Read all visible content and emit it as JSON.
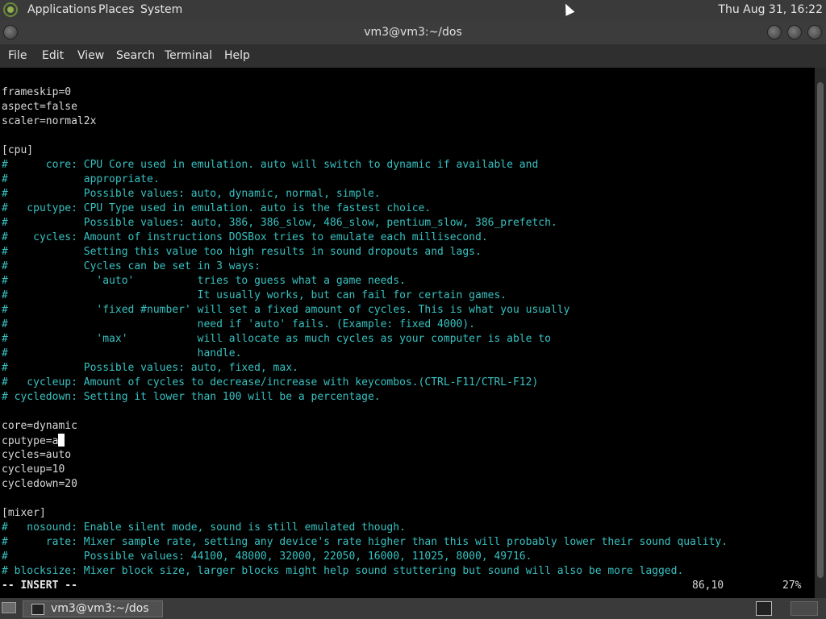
{
  "top_panel": {
    "menus": [
      "Applications",
      "Places",
      "System"
    ],
    "clock": "Thu Aug 31, 16:22"
  },
  "window": {
    "title": "vm3@vm3:~/dos"
  },
  "menubar": [
    "File",
    "Edit",
    "View",
    "Search",
    "Terminal",
    "Help"
  ],
  "terminal": {
    "lines": [
      {
        "t": "",
        "k": "n"
      },
      {
        "t": "frameskip=0",
        "k": "n"
      },
      {
        "t": "aspect=false",
        "k": "n"
      },
      {
        "t": "scaler=normal2x",
        "k": "n"
      },
      {
        "t": "",
        "k": "n"
      },
      {
        "t": "[cpu]",
        "k": "n"
      },
      {
        "t": "#      core: CPU Core used in emulation. auto will switch to dynamic if available and",
        "k": "c"
      },
      {
        "t": "#            appropriate.",
        "k": "c"
      },
      {
        "t": "#            Possible values: auto, dynamic, normal, simple.",
        "k": "c"
      },
      {
        "t": "#   cputype: CPU Type used in emulation. auto is the fastest choice.",
        "k": "c"
      },
      {
        "t": "#            Possible values: auto, 386, 386_slow, 486_slow, pentium_slow, 386_prefetch.",
        "k": "c"
      },
      {
        "t": "#    cycles: Amount of instructions DOSBox tries to emulate each millisecond.",
        "k": "c"
      },
      {
        "t": "#            Setting this value too high results in sound dropouts and lags.",
        "k": "c"
      },
      {
        "t": "#            Cycles can be set in 3 ways:",
        "k": "c"
      },
      {
        "t": "#              'auto'          tries to guess what a game needs.",
        "k": "c"
      },
      {
        "t": "#                              It usually works, but can fail for certain games.",
        "k": "c"
      },
      {
        "t": "#              'fixed #number' will set a fixed amount of cycles. This is what you usually",
        "k": "c"
      },
      {
        "t": "#                              need if 'auto' fails. (Example: fixed 4000).",
        "k": "c"
      },
      {
        "t": "#              'max'           will allocate as much cycles as your computer is able to",
        "k": "c"
      },
      {
        "t": "#                              handle.",
        "k": "c"
      },
      {
        "t": "#            Possible values: auto, fixed, max.",
        "k": "c"
      },
      {
        "t": "#   cycleup: Amount of cycles to decrease/increase with keycombos.(CTRL-F11/CTRL-F12)",
        "k": "c"
      },
      {
        "t": "# cycledown: Setting it lower than 100 will be a percentage.",
        "k": "c"
      },
      {
        "t": "",
        "k": "n"
      },
      {
        "t": "core=dynamic",
        "k": "n"
      },
      {
        "t": "cputype=a",
        "k": "n",
        "cursor": true
      },
      {
        "t": "cycles=auto",
        "k": "n"
      },
      {
        "t": "cycleup=10",
        "k": "n"
      },
      {
        "t": "cycledown=20",
        "k": "n"
      },
      {
        "t": "",
        "k": "n"
      },
      {
        "t": "[mixer]",
        "k": "n"
      },
      {
        "t": "#   nosound: Enable silent mode, sound is still emulated though.",
        "k": "c"
      },
      {
        "t": "#      rate: Mixer sample rate, setting any device's rate higher than this will probably lower their sound quality.",
        "k": "c"
      },
      {
        "t": "#            Possible values: 44100, 48000, 32000, 22050, 16000, 11025, 8000, 49716.",
        "k": "c"
      },
      {
        "t": "# blocksize: Mixer block size, larger blocks might help sound stuttering but sound will also be more lagged.",
        "k": "c"
      }
    ],
    "status": {
      "mode": "-- INSERT --",
      "position": "86,10",
      "percent": "27%"
    }
  },
  "taskbar": {
    "task_label": "vm3@vm3:~/dos"
  }
}
